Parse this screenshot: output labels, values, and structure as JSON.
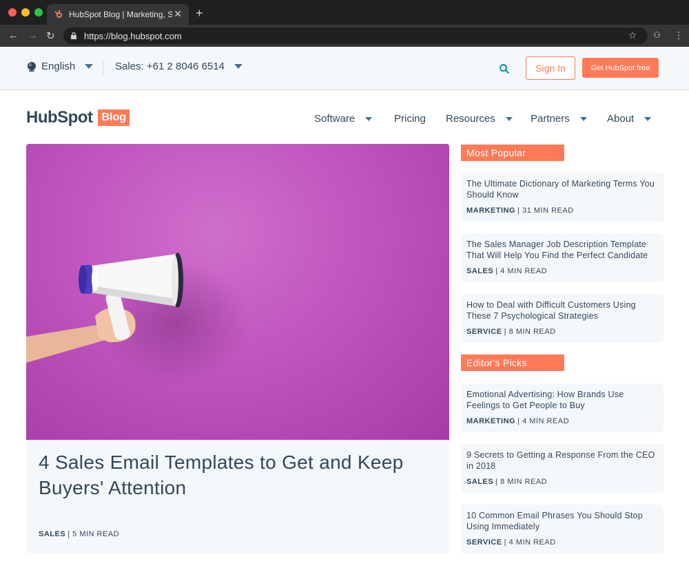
{
  "browser": {
    "tab_title": "HubSpot Blog | Marketing, Sales",
    "url": "https://blog.hubspot.com"
  },
  "utility": {
    "language": "English",
    "sales": "Sales: +61 2 8046 6514",
    "sign_in": "Sign In",
    "get_free": "Get HubSpot free"
  },
  "nav": {
    "logo_text": "HubSpot",
    "logo_badge": "Blog",
    "items": [
      {
        "label": "Software"
      },
      {
        "label": "Pricing"
      },
      {
        "label": "Resources"
      },
      {
        "label": "Partners"
      },
      {
        "label": "About"
      }
    ]
  },
  "hero": {
    "title": "4 Sales Email Templates to Get and Keep Buyers' Attention",
    "tag": "SALES",
    "read_time": "| 5 MIN READ"
  },
  "sidebar": {
    "most_popular": {
      "heading": "Most Popular",
      "posts": [
        {
          "title": "The Ultimate Dictionary of Marketing Terms You Should Know",
          "tag": "MARKETING",
          "read_time": "| 31 MIN READ"
        },
        {
          "title": "The Sales Manager Job Description Template That Will Help You Find the Perfect Candidate",
          "tag": "SALES",
          "read_time": "| 4 MIN READ"
        },
        {
          "title": "How to Deal with Difficult Customers Using These 7 Psychological Strategies",
          "tag": "SERVICE",
          "read_time": "| 8 MIN READ"
        }
      ]
    },
    "editors_picks": {
      "heading": "Editor's Picks",
      "posts": [
        {
          "title": "Emotional Advertising: How Brands Use Feelings to Get People to Buy",
          "tag": "MARKETING",
          "read_time": "| 4 MIN READ"
        },
        {
          "title": "9 Secrets to Getting a Response From the CEO in 2018",
          "tag": "SALES",
          "read_time": "| 8 MIN READ"
        },
        {
          "title": "10 Common Email Phrases You Should Stop Using Immediately",
          "tag": "SERVICE",
          "read_time": "| 4 MIN READ"
        }
      ]
    }
  },
  "colors": {
    "accent": "#ff7a59",
    "text": "#33475b",
    "card_bg": "#f5f8fa",
    "hero_bg": "#c158c0"
  }
}
